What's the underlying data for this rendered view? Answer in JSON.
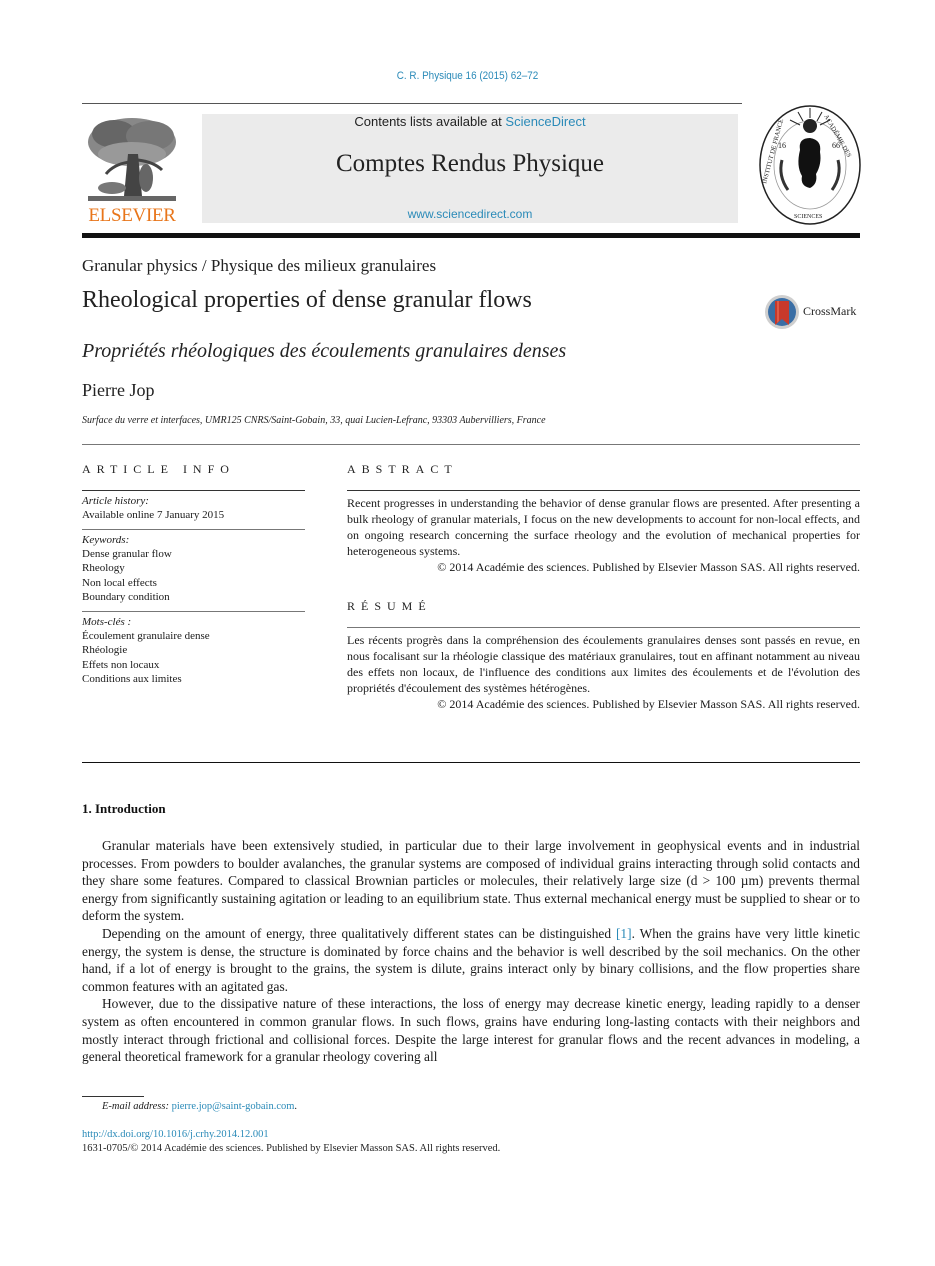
{
  "journal_ref": "C. R. Physique 16 (2015) 62–72",
  "masthead": {
    "contents_prefix": "Contents lists available at ",
    "contents_link": "ScienceDirect",
    "journal_title": "Comptes Rendus Physique",
    "url": "www.sciencedirect.com"
  },
  "logos": {
    "publisher_wordmark": "ELSEVIER",
    "crossmark_label": "CrossMark",
    "seal_text_left": "INSTITUT DE FRANCE",
    "seal_text_right": "ACADÉMIE DES SCIENCES",
    "seal_year_left": "16",
    "seal_year_right": "66"
  },
  "colors": {
    "link": "#2a8ab8",
    "publisher_orange": "#e8751a",
    "masthead_bg": "#ebebeb",
    "crossmark_red": "#c8392b",
    "crossmark_blue": "#3a6ea5"
  },
  "article": {
    "section": "Granular physics / Physique des milieux granulaires",
    "title": "Rheological properties of dense granular flows",
    "title_fr": "Propriétés rhéologiques des écoulements granulaires denses",
    "author": "Pierre Jop",
    "affiliation": "Surface du verre et interfaces, UMR125 CNRS/Saint-Gobain, 33, quai Lucien-Lefranc, 93303 Aubervilliers, France"
  },
  "article_info": {
    "heading": "ARTICLE INFO",
    "history_label": "Article history:",
    "history_value": "Available online 7 January 2015",
    "keywords_label": "Keywords:",
    "keywords": [
      "Dense granular flow",
      "Rheology",
      "Non local effects",
      "Boundary condition"
    ],
    "motscles_label": "Mots-clés :",
    "motscles": [
      "Écoulement granulaire dense",
      "Rhéologie",
      "Effets non locaux",
      "Conditions aux limites"
    ]
  },
  "abstract": {
    "heading": "ABSTRACT",
    "text": "Recent progresses in understanding the behavior of dense granular flows are presented. After presenting a bulk rheology of granular materials, I focus on the new developments to account for non-local effects, and on ongoing research concerning the surface rheology and the evolution of mechanical properties for heterogeneous systems.",
    "copyright": "© 2014 Académie des sciences. Published by Elsevier Masson SAS. All rights reserved."
  },
  "resume": {
    "heading": "RÉSUMÉ",
    "text": "Les récents progrès dans la compréhension des écoulements granulaires denses sont passés en revue, en nous focalisant sur la rhéologie classique des matériaux granulaires, tout en affinant notamment au niveau des effets non locaux, de l'influence des conditions aux limites des écoulements et de l'évolution des propriétés d'écoulement des systèmes hétérogènes.",
    "copyright": "© 2014 Académie des sciences. Published by Elsevier Masson SAS. All rights reserved."
  },
  "introduction": {
    "heading": "1. Introduction",
    "p1": "Granular materials have been extensively studied, in particular due to their large involvement in geophysical events and in industrial processes. From powders to boulder avalanches, the granular systems are composed of individual grains interacting through solid contacts and they share some features. Compared to classical Brownian particles or molecules, their relatively large size (d > 100 µm) prevents thermal energy from significantly sustaining agitation or leading to an equilibrium state. Thus external mechanical energy must be supplied to shear or to deform the system.",
    "p2_before": "Depending on the amount of energy, three qualitatively different states can be distinguished ",
    "p2_ref": "[1]",
    "p2_after": ". When the grains have very little kinetic energy, the system is dense, the structure is dominated by force chains and the behavior is well described by the soil mechanics. On the other hand, if a lot of energy is brought to the grains, the system is dilute, grains interact only by binary collisions, and the flow properties share common features with an agitated gas.",
    "p3": "However, due to the dissipative nature of these interactions, the loss of energy may decrease kinetic energy, leading rapidly to a denser system as often encountered in common granular flows. In such flows, grains have enduring long-lasting contacts with their neighbors and mostly interact through frictional and collisional forces. Despite the large interest for granular flows and the recent advances in modeling, a general theoretical framework for a granular rheology covering all"
  },
  "footer": {
    "email_label": "E-mail address:",
    "email": "pierre.jop@saint-gobain.com",
    "email_suffix": ".",
    "doi": "http://dx.doi.org/10.1016/j.crhy.2014.12.001",
    "issn_line": "1631-0705/© 2014 Académie des sciences. Published by Elsevier Masson SAS. All rights reserved."
  }
}
